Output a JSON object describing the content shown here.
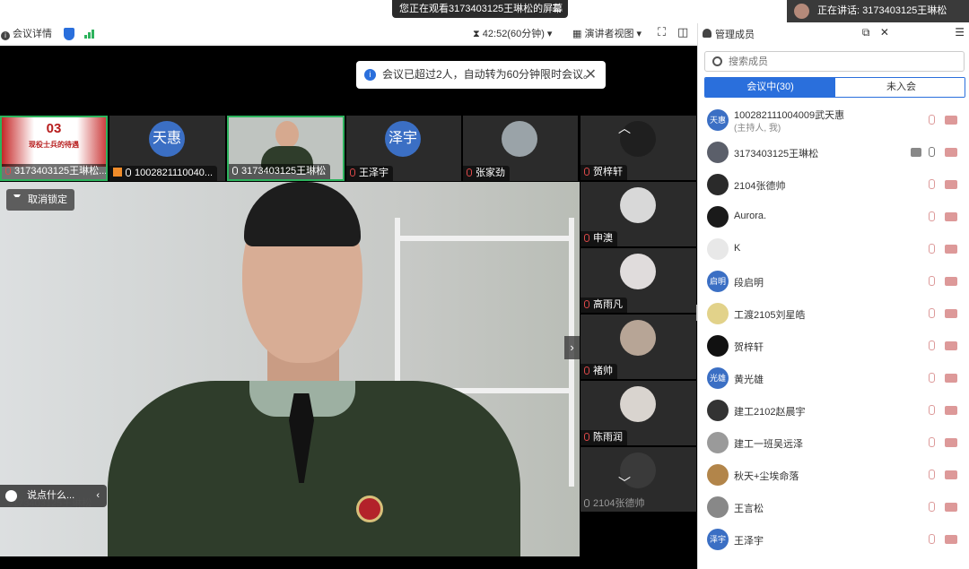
{
  "banner": {
    "text": "您正在观看3173403125王琳松的屏幕",
    "menu": "☰"
  },
  "speaking": {
    "label": "正在讲话:",
    "name": "3173403125王琳松"
  },
  "toolbar": {
    "meeting_details": "会议详情",
    "timer": "42:52(60分钟)",
    "view": "演讲者视图"
  },
  "notice": {
    "text": "会议已超过2人，自动转为60分钟限时会议。",
    "close": "✕"
  },
  "tiles_top": [
    {
      "name": "3173403125王琳松...",
      "slide_num": "03",
      "slide_title": "现役士兵的待遇"
    },
    {
      "name": "1002821110040...",
      "avatar": "天惠"
    },
    {
      "name": "3173403125王琳松"
    },
    {
      "name": "王泽宇",
      "avatar": "泽宇"
    },
    {
      "name": "张家劲"
    }
  ],
  "tiles_side": [
    {
      "name": "贺梓轩"
    },
    {
      "name": "申澳"
    },
    {
      "name": "高雨凡"
    },
    {
      "name": "褚帅"
    },
    {
      "name": "陈雨润"
    },
    {
      "name": "2104张德帅"
    }
  ],
  "main_video": {
    "unlock_label": "取消锁定",
    "chat_placeholder": "说点什么...",
    "chat_arrow": "‹",
    "name": "3173403125王琳松",
    "next_arrow": "›"
  },
  "side_nav": {
    "up": "︿",
    "down": "﹀"
  },
  "panel": {
    "title": "管理成员",
    "popout_icon": "⧉",
    "close_icon": "✕",
    "menu_icon": "☰",
    "search_placeholder": "搜索成员",
    "tab_in": "会议中(30)",
    "tab_out": "未入会"
  },
  "members": [
    {
      "name": "100282111004009武天惠",
      "sub": "(主持人, 我)",
      "avatar": "天惠",
      "color": "#3b6fc4"
    },
    {
      "name": "3173403125王琳松",
      "avatar": "",
      "color": "#5b5f6a",
      "sharing": true,
      "mic_on": true
    },
    {
      "name": "2104张德帅",
      "avatar": "",
      "color": "#2a2a2a"
    },
    {
      "name": "Aurora.",
      "avatar": "",
      "color": "#1a1a1a"
    },
    {
      "name": "K",
      "avatar": "",
      "color": "#e8e8e8"
    },
    {
      "name": "段启明",
      "avatar": "启明",
      "color": "#3b6fc4"
    },
    {
      "name": "工渡2105刘星皓",
      "avatar": "",
      "color": "#e2d28a"
    },
    {
      "name": "贺梓轩",
      "avatar": "",
      "color": "#111111"
    },
    {
      "name": "黄光雄",
      "avatar": "光雄",
      "color": "#3b6fc4"
    },
    {
      "name": "建工2102赵晨宇",
      "avatar": "",
      "color": "#333333"
    },
    {
      "name": "建工一班吴远泽",
      "avatar": "",
      "color": "#9a9a9a"
    },
    {
      "name": "秋天+尘埃命落",
      "avatar": "",
      "color": "#b2854a"
    },
    {
      "name": "王言松",
      "avatar": "",
      "color": "#888888"
    },
    {
      "name": "王泽宇",
      "avatar": "泽宇",
      "color": "#3b6fc4"
    }
  ]
}
